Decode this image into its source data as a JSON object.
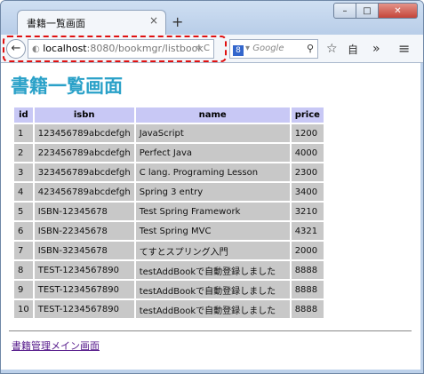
{
  "tab": {
    "title": "書籍一覧画面",
    "close": "×"
  },
  "newtab": "+",
  "window_buttons": {
    "minimize": "–",
    "maximize": "□",
    "close": "✕"
  },
  "toolbar": {
    "back": "←",
    "url_host": "localhost",
    "url_path": ":8080/bookmgr/listbook",
    "url_icons": "▿ C",
    "search_engine": "8",
    "search_placeholder": "Google",
    "search_icon": "⚲",
    "bookmark_star": "☆",
    "reading_list": "自",
    "overflow": "»",
    "menu": "≡"
  },
  "page": {
    "title": "書籍一覧画面",
    "columns": [
      "id",
      "isbn",
      "name",
      "price"
    ],
    "rows": [
      [
        "1",
        "123456789abcdefgh",
        "JavaScript",
        "1200"
      ],
      [
        "2",
        "223456789abcdefgh",
        "Perfect Java",
        "4000"
      ],
      [
        "3",
        "323456789abcdefgh",
        "C lang. Programing Lesson",
        "2300"
      ],
      [
        "4",
        "423456789abcdefgh",
        "Spring 3 entry",
        "3400"
      ],
      [
        "5",
        "ISBN-12345678",
        "Test Spring Framework",
        "3210"
      ],
      [
        "6",
        "ISBN-22345678",
        "Test Spring MVC",
        "4321"
      ],
      [
        "7",
        "ISBN-32345678",
        "てすとスプリング入門",
        "2000"
      ],
      [
        "8",
        "TEST-1234567890",
        "testAddBookで自動登録しました",
        "8888"
      ],
      [
        "9",
        "TEST-1234567890",
        "testAddBookで自動登録しました",
        "8888"
      ],
      [
        "10",
        "TEST-1234567890",
        "testAddBookで自動登録しました",
        "8888"
      ]
    ],
    "nav_link": "書籍管理メイン画面"
  },
  "colors": {
    "title": "#2aa1c8",
    "header_bg": "#c8c8f5",
    "cell_bg": "#c8c8c8",
    "highlight": "#e01010"
  }
}
